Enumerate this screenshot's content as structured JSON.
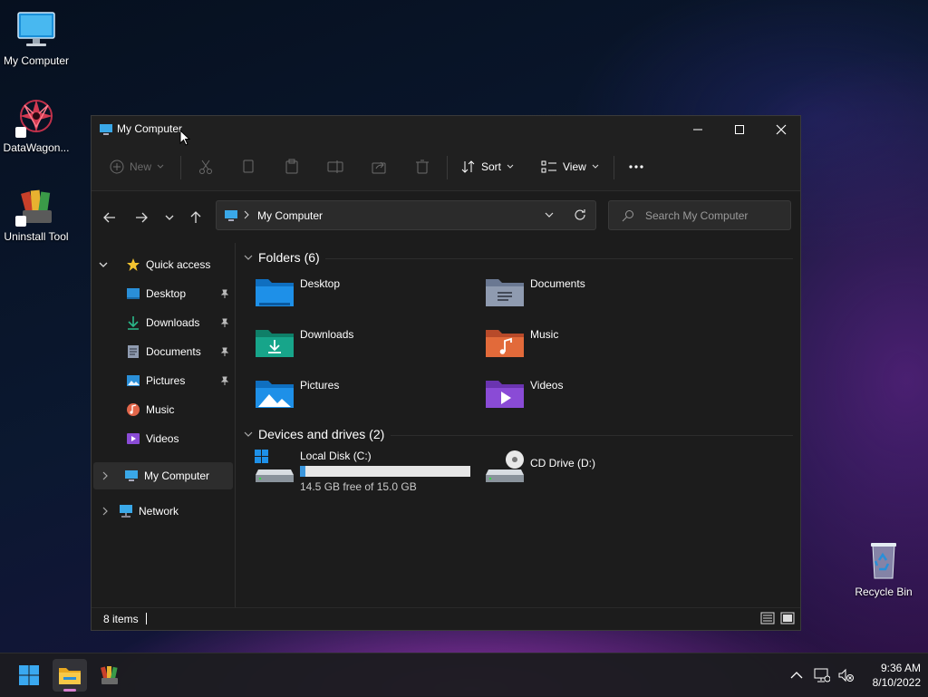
{
  "desktop": {
    "icons": [
      {
        "label": "My Computer"
      },
      {
        "label": "DataWagon..."
      },
      {
        "label": "Uninstall Tool"
      },
      {
        "label": "Recycle Bin"
      }
    ]
  },
  "window": {
    "title": "My Computer",
    "toolbar": {
      "new_label": "New",
      "sort_label": "Sort",
      "view_label": "View"
    },
    "address": {
      "path": "My Computer"
    },
    "search": {
      "placeholder": "Search My Computer"
    },
    "sidebar": {
      "quick_access": "Quick access",
      "items": [
        {
          "label": "Desktop",
          "pinned": true
        },
        {
          "label": "Downloads",
          "pinned": true
        },
        {
          "label": "Documents",
          "pinned": true
        },
        {
          "label": "Pictures",
          "pinned": true
        },
        {
          "label": "Music",
          "pinned": false
        },
        {
          "label": "Videos",
          "pinned": false
        }
      ],
      "my_computer": "My Computer",
      "network": "Network"
    },
    "content": {
      "folders_header": "Folders (6)",
      "folders": [
        {
          "name": "Desktop"
        },
        {
          "name": "Documents"
        },
        {
          "name": "Downloads"
        },
        {
          "name": "Music"
        },
        {
          "name": "Pictures"
        },
        {
          "name": "Videos"
        }
      ],
      "devices_header": "Devices and drives (2)",
      "drives": [
        {
          "name": "Local Disk (C:)",
          "free_text": "14.5 GB free of 15.0 GB",
          "used_fraction": 0.033
        },
        {
          "name": "CD Drive (D:)"
        }
      ]
    },
    "status": {
      "items": "8 items"
    }
  },
  "taskbar": {
    "time": "9:36 AM",
    "date": "8/10/2022"
  },
  "colors": {
    "accent": "#0078d4",
    "drive_bar_fill": "#3a96dd",
    "folder_blue": "#1e90e8",
    "folder_teal": "#17a58a",
    "folder_orange": "#e26a3a",
    "folder_purple": "#8a4bd6"
  }
}
